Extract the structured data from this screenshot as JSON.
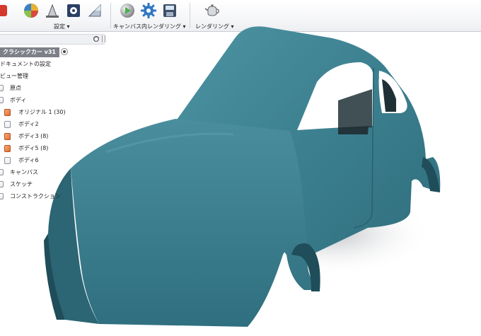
{
  "toolbar": {
    "groups": [
      {
        "label": "設定 ▾",
        "icons": [
          "material-sphere-icon",
          "cone-paint-icon",
          "decal-cube-icon",
          "scene-flag-icon"
        ]
      },
      {
        "label": "キャンバス内レンダリング ▾",
        "icons": [
          "render-sphere-icon",
          "settings-gear-icon",
          "save-image-icon"
        ]
      },
      {
        "label": "レンダリング ▾",
        "icons": [
          "teapot-icon"
        ]
      }
    ]
  },
  "browser": {
    "root": {
      "label": "クラシックカー v31"
    },
    "items": [
      {
        "label": "ドキュメントの設定"
      },
      {
        "label": "ビュー管理"
      },
      {
        "label": "原点"
      },
      {
        "label": "ボディ"
      },
      {
        "label": "オリジナル 1 (30)"
      },
      {
        "label": "ボディ2"
      },
      {
        "label": "ボディ3 (8)"
      },
      {
        "label": "ボディ5 (8)"
      },
      {
        "label": "ボディ6"
      },
      {
        "label": "キャンバス"
      },
      {
        "label": "スケッチ"
      },
      {
        "label": "コンストラクション"
      }
    ]
  },
  "viewport": {
    "model_color": "#3d7f8e",
    "background": "#ffffff"
  }
}
